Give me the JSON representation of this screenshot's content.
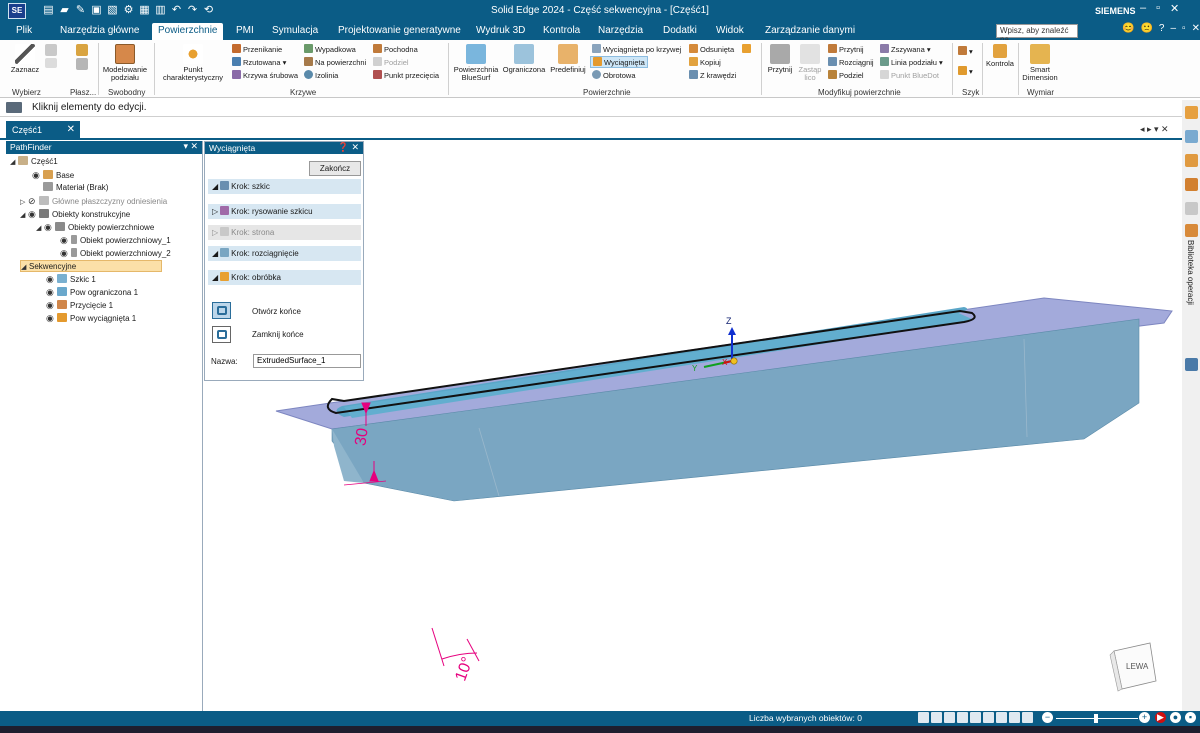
{
  "app": {
    "window_title": "Solid Edge 2024 - Część sekwencyjna - [Część1]",
    "logo": "SE",
    "brand": "SIEMENS",
    "window_controls": [
      "–",
      "▫",
      "✕"
    ]
  },
  "menu": {
    "items": [
      "Plik",
      "Narzędzia główne",
      "Powierzchnie",
      "PMI",
      "Symulacja",
      "Projektowanie generatywne",
      "Wydruk 3D",
      "Kontrola",
      "Narzędzia",
      "Dodatki",
      "Widok",
      "Zarządzanie danymi"
    ],
    "active": "Powierzchnie",
    "search_placeholder": "Wpisz, aby znaleźć na",
    "right_icons": [
      "😊",
      "🙁",
      "?",
      "–",
      "▫",
      "✕"
    ]
  },
  "ribbon": {
    "zaznacz": "Zaznacz",
    "groups": {
      "wybierz": "Wybierz",
      "plaszczyzny": "Płasz...",
      "swobodny": "Swobodny",
      "krzywe": "Krzywe",
      "powierzchnie": "Powierzchnie",
      "modyfikuj": "Modyfikuj powierzchnie",
      "szyk": "Szyk",
      "wymiar": "Wymiar"
    },
    "modelowanie": "Modelowanie podziału",
    "punkt_char": "Punkt charakterystyczny",
    "krzywe": {
      "przenikanie": "Przenikanie",
      "rzutowana": "Rzutowana",
      "krzywa_srubowa": "Krzywa śrubowa",
      "wypadkowa": "Wypadkowa",
      "na_powierzchni": "Na powierzchni",
      "izolinia": "Izolinia",
      "pochodna": "Pochodna",
      "podziel": "Podziel",
      "punkt_przeciecia": "Punkt przecięcia"
    },
    "powierzchnie": {
      "bluesurf": "Powierzchnia BlueSurf",
      "ograniczona": "Ograniczona",
      "predefiniuj": "Predefiniuj",
      "wyciagnieta_po_krzywej": "Wyciągnięta po krzywej",
      "wyciagnieta": "Wyciągnięta",
      "obrotowa": "Obrotowa",
      "odsunieta": "Odsunięta",
      "kopiuj": "Kopiuj",
      "z_krawedzi": "Z krawędzi"
    },
    "modyfikuj": {
      "przytnij": "Przytnij",
      "zastap_lico": "Zastąp lico",
      "przytnij2": "Przytnij",
      "rozciagnij": "Rozciągnij",
      "podziel": "Podziel",
      "zszywana": "Zszywana",
      "linia_podzialu": "Linia podziału",
      "punkt_bluedot": "Punkt BlueDot"
    },
    "kontrola": "Kontrola",
    "smart_dimension": "Smart Dimension"
  },
  "prompt": "Kliknij elementy do edycji.",
  "document_tab": "Część1",
  "pathfinder": {
    "title": "PathFinder",
    "tree": [
      {
        "label": "Część1",
        "level": 0
      },
      {
        "label": "Base",
        "level": 1
      },
      {
        "label": "Materiał (Brak)",
        "level": 1
      },
      {
        "label": "Główne płaszczyzny odniesienia",
        "level": 1
      },
      {
        "label": "Obiekty konstrukcyjne",
        "level": 1
      },
      {
        "label": "Obiekty powierzchniowe",
        "level": 2
      },
      {
        "label": "Obiekt powierzchniowy_1",
        "level": 3
      },
      {
        "label": "Obiekt powierzchniowy_2",
        "level": 3
      },
      {
        "label": "Sekwencyjne",
        "level": 0
      },
      {
        "label": "Szkic 1",
        "level": 1
      },
      {
        "label": "Pow ograniczona 1",
        "level": 1
      },
      {
        "label": "Przycięcie 1",
        "level": 1
      },
      {
        "label": "Pow wyciągnięta 1",
        "level": 1
      }
    ]
  },
  "extrude_panel": {
    "title": "Wyciągnięta",
    "finish": "Zakończ",
    "steps": [
      {
        "label": "Krok: szkic",
        "dim": false,
        "arrow": "◢"
      },
      {
        "label": "Krok: rysowanie szkicu",
        "dim": false,
        "arrow": "▷"
      },
      {
        "label": "Krok: strona",
        "dim": true,
        "arrow": "▷"
      },
      {
        "label": "Krok: rozciągnięcie",
        "dim": false,
        "arrow": "◢"
      },
      {
        "label": "Krok: obróbka",
        "dim": false,
        "arrow": "◢"
      }
    ],
    "open_ends": "Otwórz końce",
    "close_ends": "Zamknij końce",
    "name_label": "Nazwa:",
    "name_value": "ExtrudedSurface_1"
  },
  "viewport": {
    "dimension_depth": "30",
    "dimension_angle": "10°",
    "axis_z": "Z",
    "axis_y": "Y",
    "axis_x": "X",
    "view_cube_label": "LEWA",
    "colors": {
      "surface": "#7aa6c2",
      "inner": "#5fa8c8",
      "flange": "#a0a8da",
      "dimension": "#e6007e"
    }
  },
  "right_panel": {
    "label": "Biblioteka operacji"
  },
  "status": {
    "selected_count": "Liczba wybranych obiektów: 0"
  }
}
